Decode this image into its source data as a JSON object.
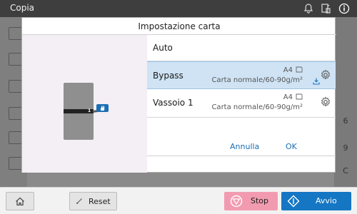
{
  "status_bar": {
    "title": "Copia"
  },
  "dialog": {
    "title": "Impostazione carta",
    "tray_number": "1",
    "options": [
      {
        "label": "Auto"
      },
      {
        "label": "Bypass",
        "size": "A4",
        "paper_type": "Carta  normale/60-90g/m²",
        "selected": true
      },
      {
        "label": "Vassoio  1",
        "size": "A4",
        "paper_type": "Carta  normale/60-90g/m²",
        "selected": false
      }
    ],
    "cancel_label": "Annulla",
    "ok_label": "OK"
  },
  "background_keys": [
    "6",
    "9",
    "C"
  ],
  "bottom": {
    "reset_label": "Reset",
    "stop_label": "Stop",
    "start_label": "Avvio"
  },
  "colors": {
    "accent": "#1576c4",
    "selected_row": "#cfe3f4",
    "stop": "#f29bb0",
    "preview_bg": "#f4eef5"
  }
}
